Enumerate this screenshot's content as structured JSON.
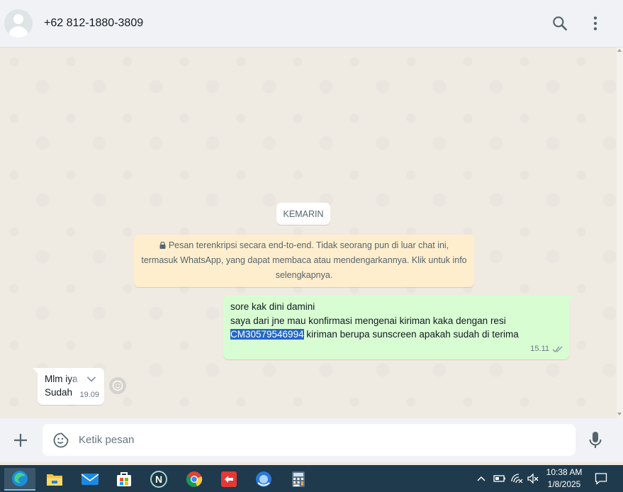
{
  "header": {
    "contact": "+62 812-1880-3809",
    "icons": [
      "avatar",
      "search-icon",
      "more-vertical-icon"
    ]
  },
  "chat": {
    "date_chip": "KEMARIN",
    "encryption": {
      "line1": "Pesan terenkripsi secara end-to-end. Tidak seorang pun di luar chat ini,",
      "line2": "termasuk WhatsApp, yang dapat membaca atau mendengarkannya. Klik untuk info",
      "line3": "selengkapnya."
    },
    "outgoing": {
      "line1": "sore kak dini damini",
      "line2": "saya dari jne mau konfirmasi mengenai kiriman kaka dengan resi",
      "resi": "CM30579546994",
      "line3_rest": " kiriman berupa sunscreen apakah sudah di terima",
      "time": "15.11",
      "status": "read"
    },
    "incoming": {
      "line1": "Mlm iya",
      "line2": "Sudah",
      "time": "19.09"
    }
  },
  "composer": {
    "placeholder": "Ketik pesan"
  },
  "taskbar": {
    "apps": [
      "edge-icon",
      "file-explorer-icon",
      "mail-icon",
      "store-icon",
      "n-app-icon",
      "chrome-icon",
      "red-app-icon",
      "blue-app-icon",
      "calculator-icon"
    ],
    "time": "10:38 AM",
    "date": "1/8/2025"
  },
  "colors": {
    "outgoing_bubble": "#d9fdd3",
    "encryption_bg": "#ffeecd",
    "chat_bg": "#efeae2",
    "selection": "#2468c7",
    "taskbar": "#1f3a4d"
  }
}
